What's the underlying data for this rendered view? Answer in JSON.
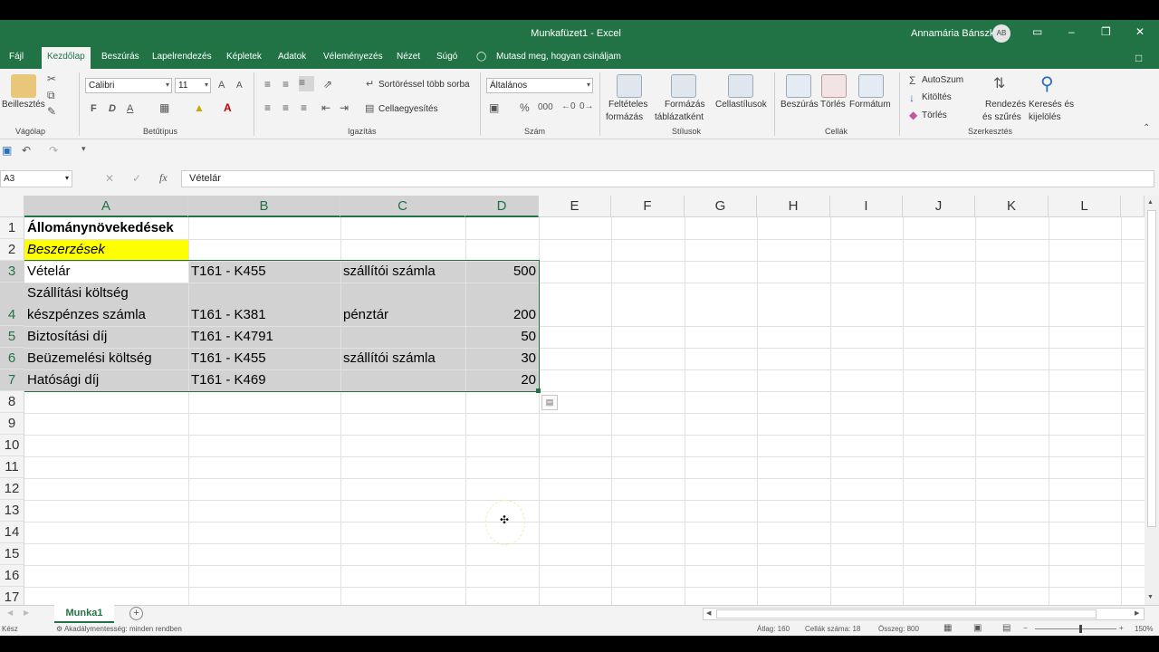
{
  "window": {
    "title": "Munkafüzet1  -  Excel",
    "user": "Annamária Bánszki",
    "user_initials": "AB",
    "controls": [
      "▭",
      "–",
      "❐",
      "✕"
    ]
  },
  "ribbon_tabs": [
    "Fájl",
    "Kezdőlap",
    "Beszúrás",
    "Lapelrendezés",
    "Képletek",
    "Adatok",
    "Véleményezés",
    "Nézet",
    "Súgó"
  ],
  "active_tab": "Kezdőlap",
  "tell_me": "Mutasd meg, hogyan csináljam",
  "ribbon": {
    "clipboard": {
      "paste": "Beillesztés",
      "label": "Vágólap"
    },
    "font": {
      "name": "Calibri",
      "size": "11",
      "bold": "F",
      "italic": "D",
      "underline": "A",
      "label": "Betűtípus"
    },
    "alignment": {
      "wrap": "Sortöréssel több sorba",
      "merge": "Cellaegyesítés",
      "label": "Igazítás"
    },
    "number": {
      "format": "Általános",
      "label": "Szám"
    },
    "styles": {
      "conditional": "Feltételes",
      "conditional2": "formázás",
      "table": "Formázás",
      "table2": "táblázatként",
      "cell": "Cellastílusok",
      "label": "Stílusok"
    },
    "cells": {
      "insert": "Beszúrás",
      "delete": "Törlés",
      "format": "Formátum",
      "label": "Cellák"
    },
    "editing": {
      "autosum": "AutoSzum",
      "fill": "Kitöltés",
      "clear": "Törlés",
      "sort": "Rendezés",
      "sort2": "és szűrés",
      "find": "Keresés és",
      "find2": "kijelölés",
      "label": "Szerkesztés"
    }
  },
  "formula_bar": {
    "name_box": "A3",
    "fx": "fx",
    "content": "Vételár"
  },
  "colors": {
    "excel_green": "#217346",
    "highlight": "#FFFF00",
    "selection": "#D2D2D2"
  },
  "columns": [
    "A",
    "B",
    "C",
    "D",
    "E",
    "F",
    "G",
    "H",
    "I",
    "J",
    "K",
    "L"
  ],
  "rows": [
    "1",
    "2",
    "3",
    "4",
    "5",
    "6",
    "7",
    "8",
    "9",
    "10",
    "11",
    "12",
    "13",
    "14",
    "15",
    "16",
    "17"
  ],
  "cells": {
    "a1": "Állománynövekedések",
    "a2": "Beszerzések",
    "a3": "Vételár",
    "b3": "T161 - K455",
    "c3": "szállítói számla",
    "d3": "500",
    "a4_line1": "Szállítási költség",
    "a4_line2": "készpénzes számla",
    "b4": "T161 - K381",
    "c4": "pénztár",
    "d4": "200",
    "a5": "Biztosítási díj",
    "b5": "T161 - K4791",
    "d5": "50",
    "a6": "Beüzemelési költség",
    "b6": "T161 - K455",
    "c6": "szállítói számla",
    "d6": "30",
    "a7": "Hatósági díj",
    "b7": "T161 - K469",
    "d7": "20"
  },
  "sheet_tab": "Munka1",
  "status": {
    "ready": "Kész",
    "accessibility": "Akadálymentesség: minden rendben",
    "average": "Átlag: 160",
    "count": "Cellák száma: 18",
    "sum": "Összeg: 800",
    "zoom": "150%"
  }
}
